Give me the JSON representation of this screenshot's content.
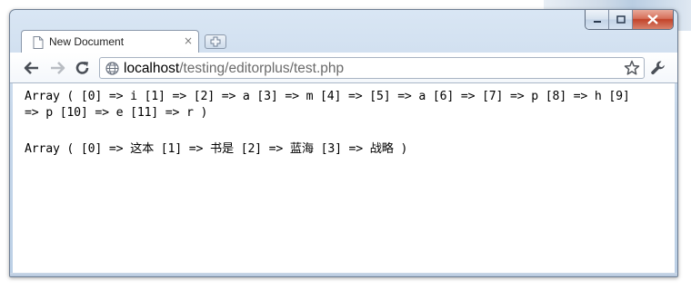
{
  "window": {
    "tab_title": "New Document",
    "tab_close": "×",
    "new_tab_icon": "new-tab-icon"
  },
  "toolbar": {
    "back_icon": "back-arrow-icon",
    "forward_icon": "forward-arrow-icon",
    "reload_icon": "reload-icon",
    "url_host": "localhost",
    "url_path": "/testing/editorplus/test.php",
    "bookmark_icon": "star-icon",
    "menu_icon": "wrench-icon"
  },
  "page": {
    "lines": [
      "Array ( [0] => i [1] => [2] => a [3] => m [4] => [5] => a [6] => [7] => p [8] => h [9]",
      "=> p [10] => e [11] => r )",
      "Array ( [0] => 这本 [1] => 书是 [2] => 蓝海 [3] => 战略 )"
    ]
  },
  "colors": {
    "frame": "#c6d7ea",
    "close_button": "#c2432a",
    "url_path": "#6a6a6a"
  }
}
